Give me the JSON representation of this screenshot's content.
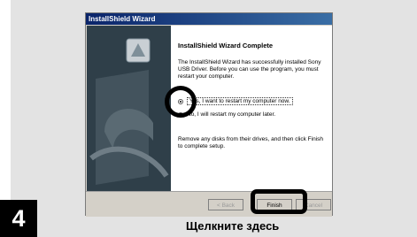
{
  "window": {
    "title": "InstallShield Wizard"
  },
  "content": {
    "heading": "InstallShield Wizard Complete",
    "description": "The InstallShield Wizard has successfully installed Sony USB Driver. Before you can use the program, you must restart your computer.",
    "radio_restart_now": "Yes, I want to restart my computer now.",
    "radio_restart_later": "No, I will restart my computer later.",
    "footer": "Remove any disks from their drives, and then click Finish to complete setup."
  },
  "buttons": {
    "back": "< Back",
    "finish": "Finish",
    "cancel": "Cancel"
  },
  "step": {
    "number": "4",
    "caption": "Щелкните здесь"
  }
}
